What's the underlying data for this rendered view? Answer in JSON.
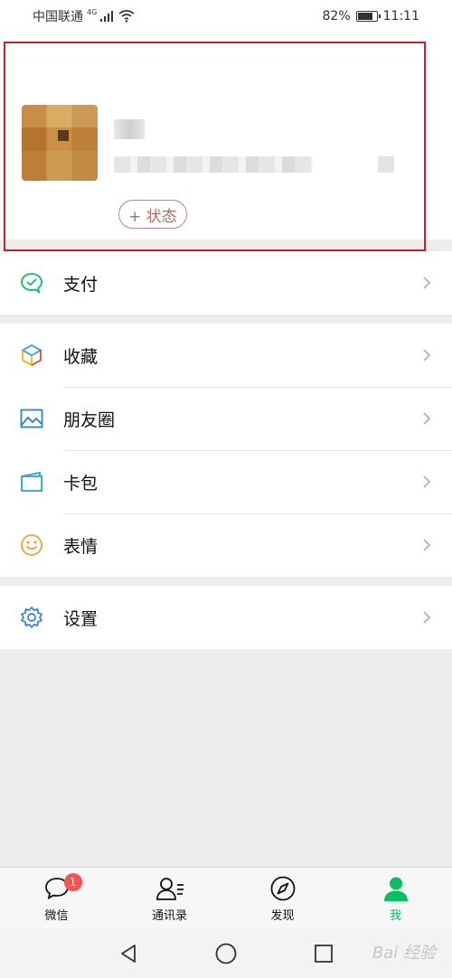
{
  "status_bar": {
    "carrier": "中国联通",
    "network": "4G",
    "battery": "82%",
    "battery_level": 0.82,
    "time": "11:11"
  },
  "profile": {
    "nickname": "",
    "wechat_id": "",
    "status_button": "+ 状态"
  },
  "menu": {
    "pay": "支付",
    "favorites": "收藏",
    "moments": "朋友圈",
    "cards": "卡包",
    "stickers": "表情",
    "settings": "设置"
  },
  "tabbar": {
    "tabs": [
      {
        "label": "微信",
        "badge": "1"
      },
      {
        "label": "通讯录"
      },
      {
        "label": "发现"
      },
      {
        "label": "我"
      }
    ]
  },
  "colors": {
    "accent": "#07c160",
    "badge": "#fa5151",
    "highlight_border": "#c8202a"
  },
  "watermark": "Bai 经验"
}
